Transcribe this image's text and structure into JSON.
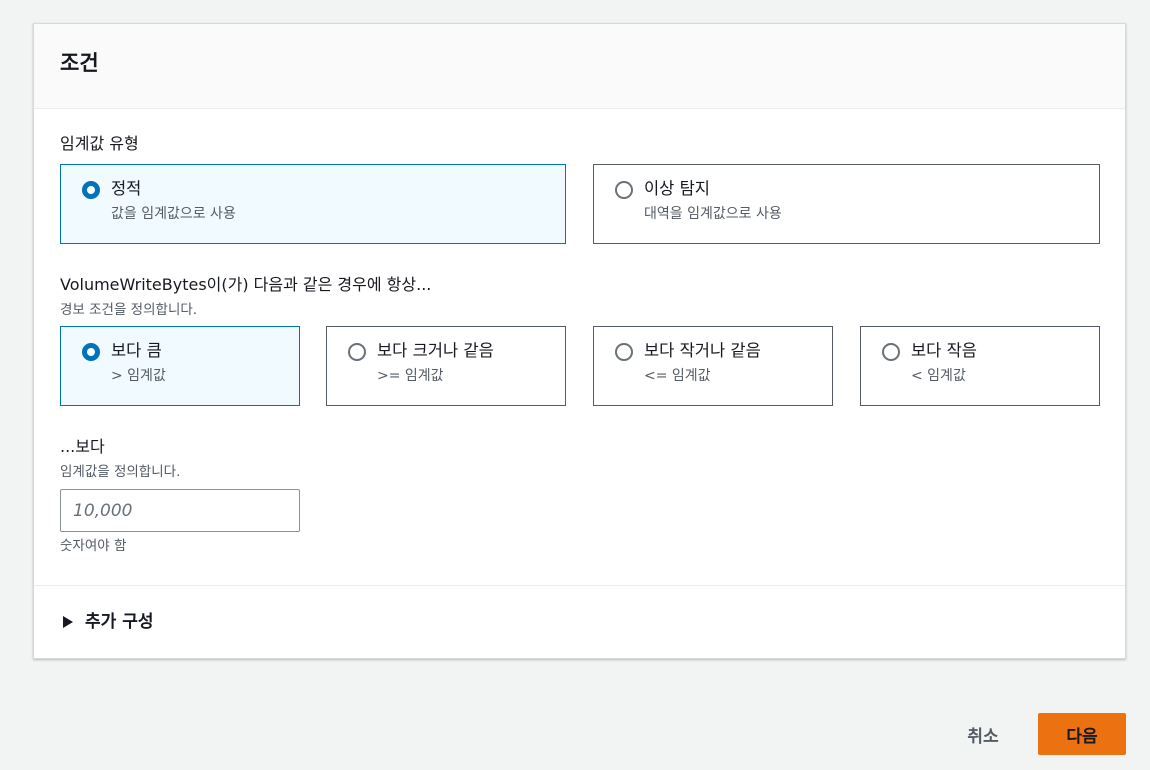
{
  "panel": {
    "title": "조건"
  },
  "threshold_type": {
    "label": "임계값 유형",
    "options": [
      {
        "label": "정적",
        "desc": "값을 임계값으로 사용",
        "selected": true
      },
      {
        "label": "이상 탐지",
        "desc": "대역을 임계값으로 사용",
        "selected": false
      }
    ]
  },
  "condition": {
    "label": "VolumeWriteBytes이(가) 다음과 같은 경우에 항상...",
    "desc": "경보 조건을 정의합니다.",
    "options": [
      {
        "label": "보다 큼",
        "desc": "> 임계값",
        "selected": true
      },
      {
        "label": "보다 크거나 같음",
        "desc": ">= 임계값",
        "selected": false
      },
      {
        "label": "보다 작거나 같음",
        "desc": "<= 임계값",
        "selected": false
      },
      {
        "label": "보다 작음",
        "desc": "< 임계값",
        "selected": false
      }
    ]
  },
  "threshold": {
    "label": "...보다",
    "desc": "임계값을 정의합니다.",
    "value": "",
    "placeholder": "10,000",
    "constraint": "숫자여야 함"
  },
  "additional": {
    "label": "추가 구성"
  },
  "footer": {
    "cancel_label": "취소",
    "next_label": "다음"
  },
  "colors": {
    "accent": "#0073bb",
    "primary_button": "#ec7211",
    "selected_tile_bg": "#f1faff"
  }
}
